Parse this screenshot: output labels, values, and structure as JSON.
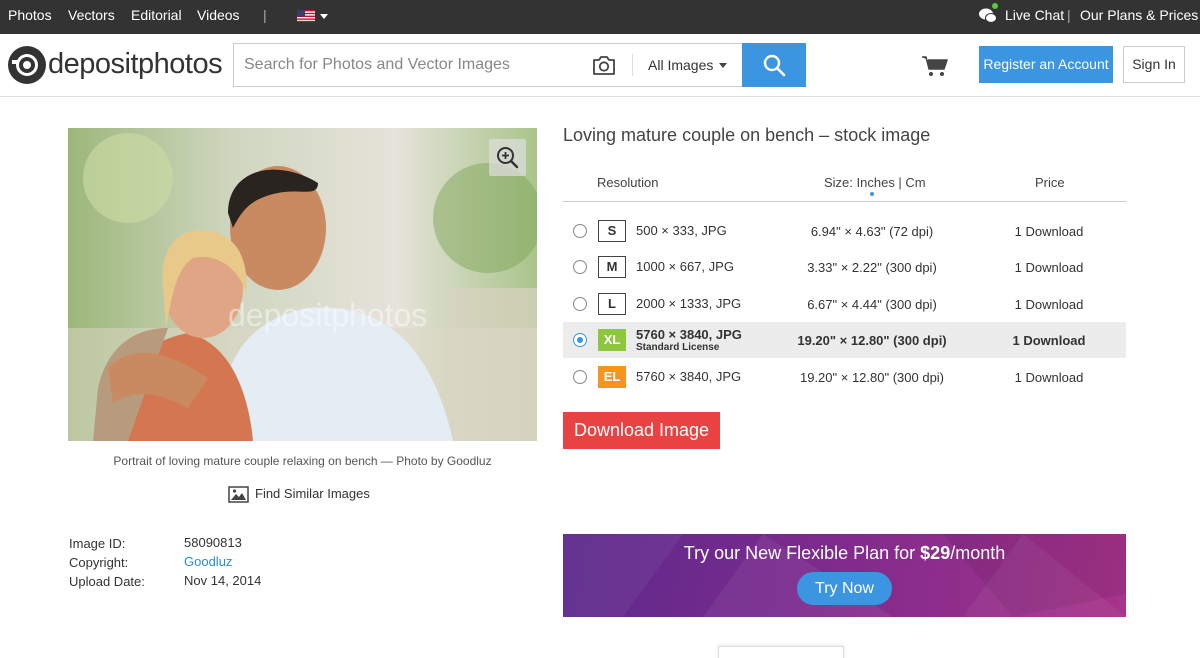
{
  "topbar": {
    "nav": [
      "Photos",
      "Vectors",
      "Editorial",
      "Videos"
    ],
    "separator": "|",
    "live_chat": "Live Chat",
    "plans": "Our Plans & Prices"
  },
  "header": {
    "logo": "depositphotos",
    "search_placeholder": "Search for Photos and Vector Images",
    "image_type": "All Images",
    "register": "Register an Account",
    "sign_in": "Sign In"
  },
  "image": {
    "caption": "Portrait of loving mature couple relaxing on bench — Photo by Goodluz",
    "find_similar": "Find Similar Images",
    "watermark": "depositphotos"
  },
  "meta": {
    "id_label": "Image ID:",
    "id_value": "58090813",
    "copyright_label": "Copyright:",
    "copyright_value": "Goodluz",
    "upload_label": "Upload Date:",
    "upload_value": "Nov 14, 2014"
  },
  "product": {
    "title": "Loving mature couple on bench  –  stock image",
    "headers": {
      "resolution": "Resolution",
      "size": "Size: Inches | Cm",
      "price": "Price"
    },
    "rows": [
      {
        "badge": "S",
        "res": "500 × 333, JPG",
        "dim": "6.94\" × 4.63\" (72 dpi)",
        "price": "1 Download"
      },
      {
        "badge": "M",
        "res": "1000 × 667, JPG",
        "dim": "3.33\" × 2.22\" (300 dpi)",
        "price": "1 Download"
      },
      {
        "badge": "L",
        "res": "2000 × 1333, JPG",
        "dim": "6.67\" × 4.44\" (300 dpi)",
        "price": "1 Download"
      },
      {
        "badge": "XL",
        "res": "5760 × 3840, JPG",
        "license": "Standard License",
        "dim": "19.20\" × 12.80\" (300 dpi)",
        "price": "1 Download"
      },
      {
        "badge": "EL",
        "res": "5760 × 3840, JPG",
        "dim": "19.20\" × 12.80\" (300 dpi)",
        "price": "1 Download"
      }
    ],
    "download": "Download Image"
  },
  "banner": {
    "text_pre": "Try our New Flexible Plan for ",
    "price": "$29",
    "text_post": "/month",
    "button": "Try Now"
  },
  "colors": {
    "accent": "#3b95e0",
    "download": "#e84242",
    "xl_badge": "#8dc63f",
    "el_badge": "#f7941d"
  }
}
